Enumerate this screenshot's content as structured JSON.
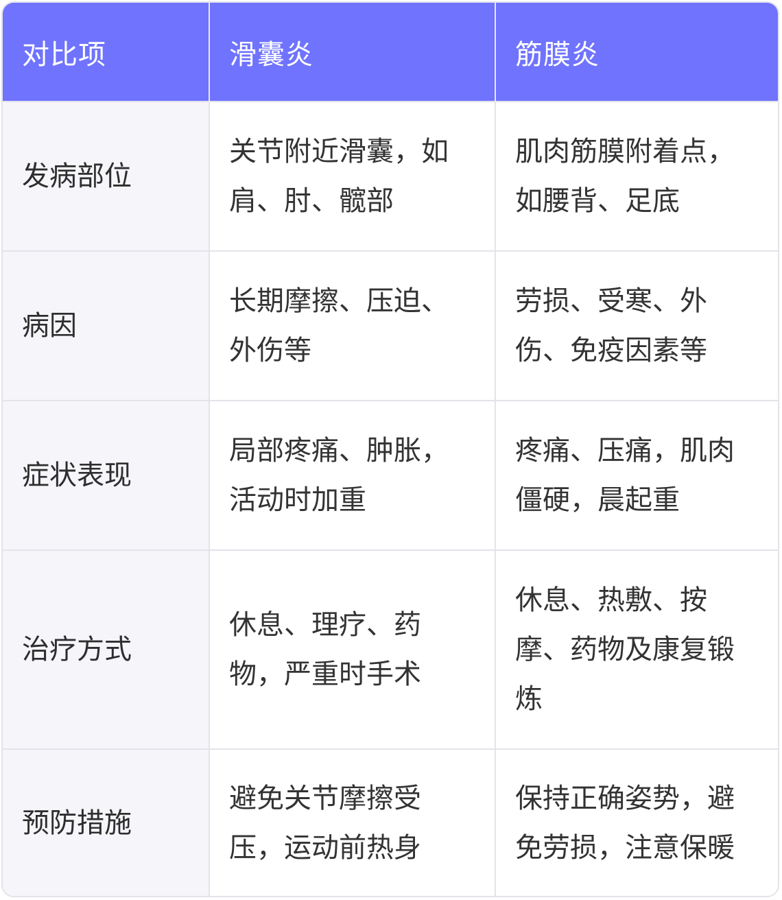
{
  "table": {
    "headers": [
      "对比项",
      "滑囊炎",
      "筋膜炎"
    ],
    "rows": [
      {
        "item": "发病部位",
        "bursitis": "关节附近滑囊，如肩、肘、髋部",
        "fasciitis": "肌肉筋膜附着点，如腰背、足底"
      },
      {
        "item": "病因",
        "bursitis": "长期摩擦、压迫、外伤等",
        "fasciitis": "劳损、受寒、外伤、免疫因素等"
      },
      {
        "item": "症状表现",
        "bursitis": "局部疼痛、肿胀，活动时加重",
        "fasciitis": "疼痛、压痛，肌肉僵硬，晨起重"
      },
      {
        "item": "治疗方式",
        "bursitis": "休息、理疗、药物，严重时手术",
        "fasciitis": "休息、热敷、按摩、药物及康复锻炼"
      },
      {
        "item": "预防措施",
        "bursitis": "避免关节摩擦受压，运动前热身",
        "fasciitis": "保持正确姿势，避免劳损，注意保暖"
      }
    ]
  },
  "colors": {
    "header_bg": "#6f73fe",
    "header_text": "#ffffff",
    "first_col_bg": "#f5f5fa",
    "border": "#e3e3ea",
    "body_text": "#333333"
  }
}
